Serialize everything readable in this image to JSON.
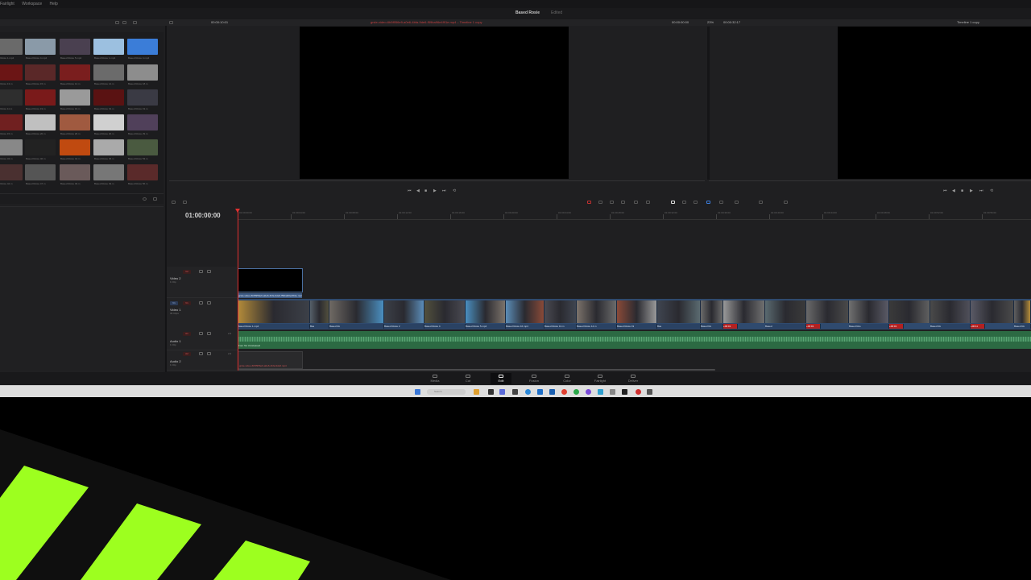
{
  "menu": [
    "Fairlight",
    "Workspace",
    "Help"
  ],
  "title": {
    "project": "Based Rosie",
    "status": "Edited"
  },
  "source_viewer": {
    "timecode": "00:00:10:01",
    "clip_name": "grsle-video-6b5f956e9-a0e6-4bfa-9de6-f59ba96e4f91e.mp4 – Timeline 1 copy"
  },
  "program_viewer": {
    "timecode_left": "00:00:00:00",
    "zoom": "23%",
    "timecode_right": "00:00:32:17",
    "timeline_name": "Timeline 1 copy"
  },
  "pool_labels": [
    "Based Rosie 1.mp4",
    "Based Rosie 4.mp4",
    "Based Rosie 5.mp4",
    "Based Rosie 1.mp4",
    "Based Rosie 4.mp4",
    "Based Rosie 13.m",
    "Based Rosie 15.m",
    "Based Rosie 14.m",
    "Based Rosie 14.m",
    "Based Rosie 18.m",
    "Based Rosie 11.m",
    "Based Rosie 19.m",
    "Based Rosie 19.m",
    "Based Rosie 19.m",
    "Based Rosie 19.m",
    "Based Rosie 15.m",
    "Based Rosie 20.m",
    "Based Rosie 20.m",
    "Based Rosie 20.m",
    "Based Rosie 29.m",
    "Based Rosie 34.m",
    "Based Rosie 40.m",
    "Based Rosie 44.m",
    "Based Rosie 45.m",
    "Based Rosie 53.m",
    "Based Rosie 42.m",
    "Based Rosie 47.m",
    "Based Rosie 49.m",
    "Based Rosie 49.m",
    "Based Rosie 56.m"
  ],
  "timeline": {
    "timecode": "01:00:00:00",
    "ruler": [
      "01:00:00:00",
      "01:00:04:00",
      "01:00:08:00",
      "01:00:12:00",
      "01:00:16:00",
      "01:00:20:00",
      "01:00:24:00",
      "01:00:28:00",
      "01:00:32:00",
      "01:00:36:00",
      "01:00:40:00",
      "01:00:44:00",
      "01:00:48:00",
      "01:00:52:00",
      "01:00:56:00"
    ],
    "tracks": {
      "v2": {
        "badge": "V2",
        "name": "Video 2",
        "sub": "1 Clip"
      },
      "v1": {
        "badge": "V1",
        "name": "Video 1",
        "sub": "30 Clips"
      },
      "a1": {
        "badge": "A1",
        "name": "Audio 1",
        "sub": "1 Clip",
        "level": "2.0"
      },
      "a2": {
        "badge": "A2",
        "name": "Audio 2",
        "sub": "1 Clip",
        "level": "2.0"
      }
    },
    "v2_clip_label": "grsle-video-6b5f956e9-a0e6-4bfa-9de6-f59ba96e4f91e.mp4",
    "v1_clip_labels": [
      "Based Rosie 1.mp4",
      "Bas",
      "Based Ro",
      "Based Rosie 2",
      "Based Rosie 4",
      "Based Rosie 5.mp4",
      "Based Rosie 16.mp4",
      "Based Rosie 13.m",
      "Based Rosie 14.m",
      "Based Rosie 19",
      "Bas",
      "Based Ro",
      "+00:01",
      "Based",
      "+00:01",
      "Based Ros",
      "+00:01",
      "Based Ro",
      "+00:11",
      "Based Ro",
      "Based Rosie 5",
      "Based Ro"
    ],
    "a1_clip_label": "Four Tet Unreleased",
    "a2_clip_label": "grsle-video-6b5f956e9-a0e6-4bfa-9de6.mp4"
  },
  "pages": [
    "Media",
    "Cut",
    "Edit",
    "Fusion",
    "Color",
    "Fairlight",
    "Deliver"
  ],
  "active_page": "Edit",
  "taskbar": {
    "search_placeholder": "Search"
  },
  "colors": {
    "accent_red": "#e03030",
    "video_clip": "#2f4a6e",
    "audio_clip": "#2c6a43",
    "deco_green": "#9dff1f"
  }
}
